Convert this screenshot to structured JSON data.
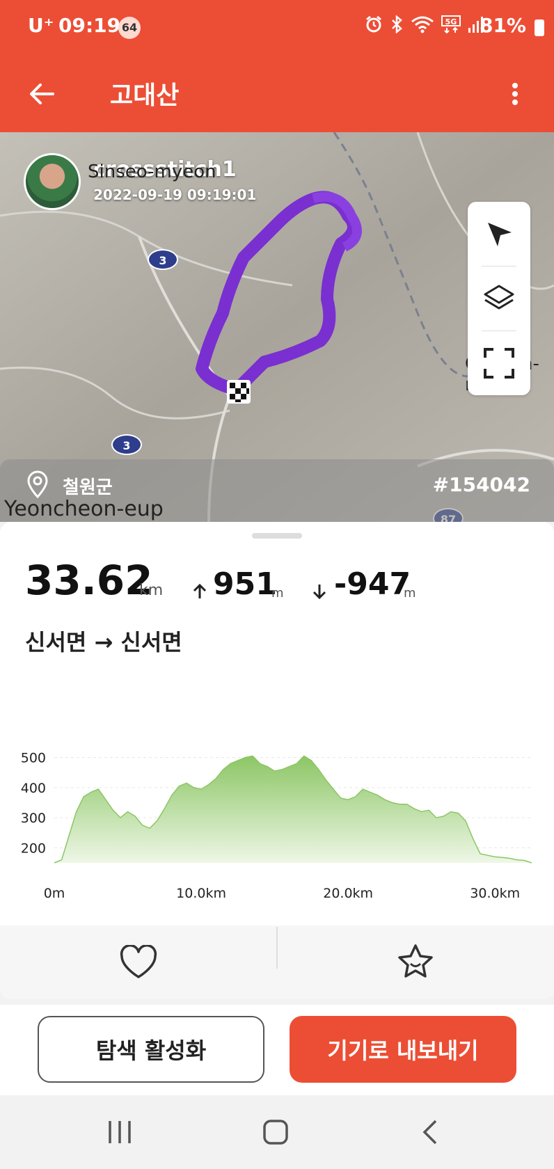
{
  "status_bar": {
    "carrier": "U⁺",
    "time": "09:19",
    "badge": "64",
    "icons": [
      "alarm-icon",
      "bluetooth-icon",
      "wifi-icon",
      "5g-icon",
      "signal-icon"
    ],
    "battery": "81%"
  },
  "app_bar": {
    "title": "고대산",
    "back_icon": "arrow-left-icon",
    "more_icon": "more-vertical-icon"
  },
  "map": {
    "user": {
      "name": "crossstitch1",
      "datetime": "2022-09-19 09:19:01"
    },
    "labels": {
      "top_left": "Sinseo-myeon",
      "bottom_left": "Yeoncheon-eup",
      "right": "Gwanin-m"
    },
    "road_badges": [
      "3",
      "3",
      "87"
    ],
    "controls": [
      "navigate-icon",
      "layers-icon",
      "fullscreen-icon"
    ],
    "location": "철원군",
    "route_id": "#154042",
    "colors": {
      "route": "#7a2fd0",
      "accent": "#ec4e35"
    }
  },
  "stats": {
    "distance": "33.62",
    "distance_unit": "km",
    "ascent": "951",
    "ascent_unit": "m",
    "descent": "-947",
    "descent_unit": "m",
    "route": "신서면 → 신서면"
  },
  "chart_data": {
    "type": "area",
    "xlabel": "",
    "ylabel": "",
    "x_ticks": [
      "0m",
      "10.0km",
      "20.0km",
      "30.0km"
    ],
    "y_ticks": [
      "500",
      "400",
      "300",
      "200"
    ],
    "xlim": [
      0,
      32.5
    ],
    "ylim": [
      150,
      520
    ],
    "x": [
      0,
      0.5,
      1,
      1.5,
      2,
      2.5,
      3,
      3.5,
      4,
      4.5,
      5,
      5.5,
      6,
      6.5,
      7,
      7.5,
      8,
      8.5,
      9,
      9.5,
      10,
      10.5,
      11,
      11.5,
      12,
      12.5,
      13,
      13.5,
      14,
      14.5,
      15,
      15.5,
      16,
      16.5,
      17,
      17.5,
      18,
      18.5,
      19,
      19.5,
      20,
      20.5,
      21,
      21.5,
      22,
      22.5,
      23,
      23.5,
      24,
      24.5,
      25,
      25.5,
      26,
      26.5,
      27,
      27.5,
      28,
      28.5,
      29,
      29.5,
      30,
      30.5,
      31,
      31.5,
      32,
      32.5
    ],
    "values": [
      150,
      160,
      240,
      320,
      370,
      385,
      395,
      360,
      325,
      300,
      320,
      305,
      275,
      265,
      290,
      330,
      375,
      405,
      415,
      400,
      395,
      410,
      430,
      460,
      480,
      490,
      500,
      505,
      480,
      470,
      455,
      460,
      470,
      480,
      505,
      490,
      460,
      425,
      395,
      365,
      360,
      370,
      395,
      385,
      375,
      360,
      350,
      345,
      345,
      330,
      320,
      325,
      300,
      305,
      320,
      315,
      290,
      230,
      180,
      175,
      170,
      168,
      165,
      160,
      158,
      150
    ],
    "fill_color": "#8cc665",
    "fill_fade": "#eef7e6",
    "grid": true
  },
  "actions": {
    "like_icon": "heart-icon",
    "favorite_icon": "star-smile-icon"
  },
  "buttons": {
    "explore": "탐색 활성화",
    "export": "기기로 내보내기"
  },
  "nav": [
    "recent-apps-icon",
    "home-icon",
    "back-icon"
  ]
}
